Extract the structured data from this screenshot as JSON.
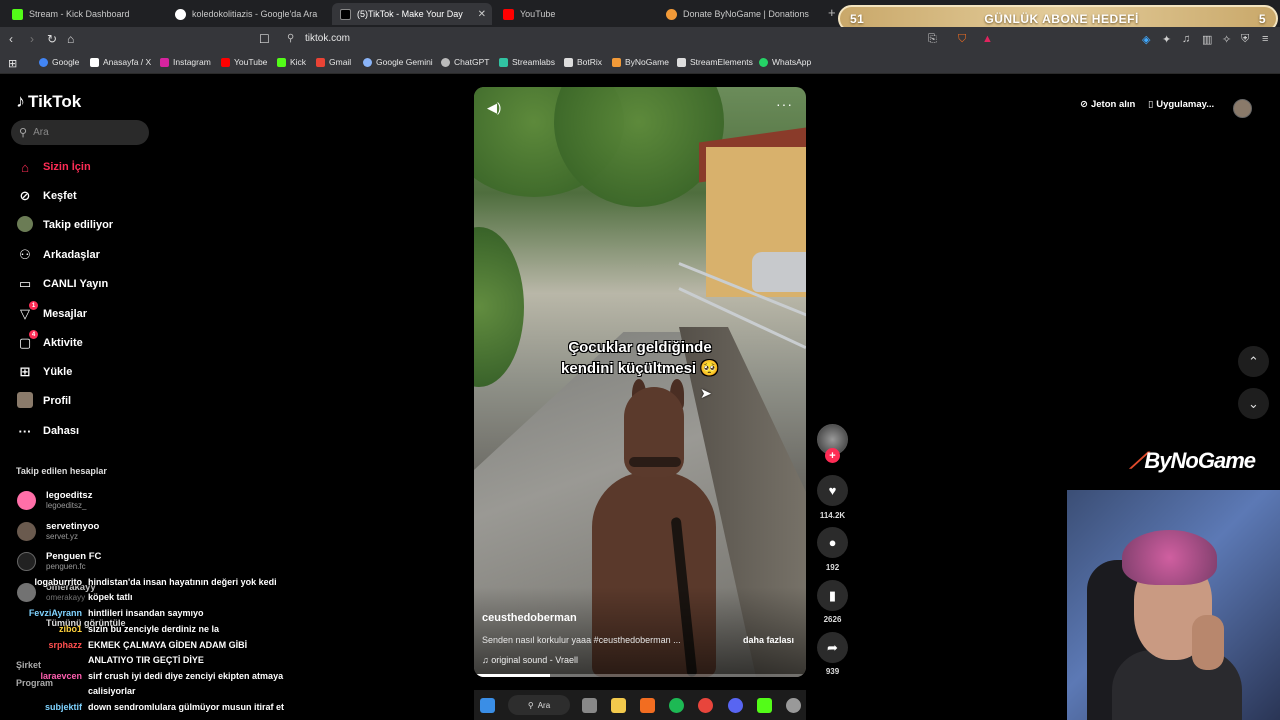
{
  "tabs": [
    {
      "title": "Stream - Kick Dashboard",
      "color": "#53fc18"
    },
    {
      "title": "koledokolitiazis - Google'da Ara",
      "color": "#ffffff"
    },
    {
      "title": "(5)TikTok - Make Your Day",
      "color": "#000000",
      "active": true
    },
    {
      "title": "YouTube",
      "color": "#ff0000"
    },
    {
      "title": "Donate ByNoGame | Donations",
      "color": "#f29a38"
    }
  ],
  "overlay": {
    "goal_left": "51",
    "goal_title": "GÜNLÜK ABONE HEDEFİ",
    "goal_right": "5"
  },
  "address": {
    "url": "tiktok.com"
  },
  "bookmarks": [
    "Google",
    "Anasayfa / X",
    "Instagram",
    "YouTube",
    "Kick",
    "Gmail",
    "Google Gemini",
    "ChatGPT",
    "Streamlabs",
    "BotRix",
    "ByNoGame",
    "StreamElements",
    "WhatsApp"
  ],
  "sidebar": {
    "logo": "TikTok",
    "search_placeholder": "Ara",
    "items": [
      {
        "label": "Sizin İçin",
        "icon": "home-icon"
      },
      {
        "label": "Keşfet",
        "icon": "compass-icon"
      },
      {
        "label": "Takip ediliyor",
        "icon": "avatar"
      },
      {
        "label": "Arkadaşlar",
        "icon": "friends-icon"
      },
      {
        "label": "CANLI Yayın",
        "icon": "live-icon"
      },
      {
        "label": "Mesajlar",
        "icon": "messages-icon",
        "badge": "1"
      },
      {
        "label": "Aktivite",
        "icon": "activity-icon",
        "badge": "4"
      },
      {
        "label": "Yükle",
        "icon": "upload-icon"
      },
      {
        "label": "Profil",
        "icon": "avatar"
      },
      {
        "label": "Dahası",
        "icon": "more-icon"
      }
    ],
    "following_title": "Takip edilen hesaplar",
    "accounts": [
      {
        "name": "legoeditsz",
        "handle": "legoeditsz_"
      },
      {
        "name": "servetinyoo",
        "handle": "servet.yz"
      },
      {
        "name": "Penguen FC",
        "handle": "penguen.fc"
      },
      {
        "name": "omerakayy",
        "handle": "omerakayy"
      }
    ],
    "see_all": "Tümünü görüntüle",
    "footer": [
      "Şirket",
      "Program"
    ]
  },
  "chat": [
    {
      "user": "logaburrito",
      "color": "#ffffff",
      "msg": "hindistan'da insan hayatının değeri yok kedi"
    },
    {
      "user": "",
      "color": "#ffffff",
      "msg": "köpek tatlı"
    },
    {
      "user": "FevziAyrann",
      "color": "#7fd3ff",
      "msg": "hintlileri insandan saymıyo"
    },
    {
      "user": "zibo1",
      "color": "#ffd23c",
      "msg": "sizin bu zenciyle derdiniz ne la"
    },
    {
      "user": "srphazz",
      "color": "#ff4f4f",
      "msg": "EKMEK ÇALMAYA GİDEN ADAM GİBİ"
    },
    {
      "user": "",
      "color": "#ffffff",
      "msg": "ANLATIYO TIR GEÇTİ DİYE"
    },
    {
      "user": "laraevcen",
      "color": "#ff5fb0",
      "msg": "sirf crush iyi dedi diye zenciyi ekipten atmaya"
    },
    {
      "user": "",
      "color": "#ffffff",
      "msg": "calisiyorlar"
    },
    {
      "user": "subjektif",
      "color": "#7fd3ff",
      "msg": "down sendromlulara gülmüyor musun itiraf et"
    }
  ],
  "video": {
    "caption_line1": "Çocuklar geldiğinde",
    "caption_line2": "kendini küçültmesi 🥺",
    "author": "ceusthedoberman",
    "description": "Senden nasıl korkulur yaaa #ceusthedoberman ...",
    "more": "daha fazlası",
    "sound": "original sound - Vraell",
    "progress": 0.23
  },
  "actions": {
    "likes": "114.2K",
    "comments": "192",
    "saves": "2626",
    "shares": "939"
  },
  "top_right": {
    "coins": "Jeton alın",
    "app": "Uygulamay..."
  },
  "brand": {
    "bynogame": "ByNoGame"
  },
  "taskbar": {
    "search": "Ara"
  }
}
